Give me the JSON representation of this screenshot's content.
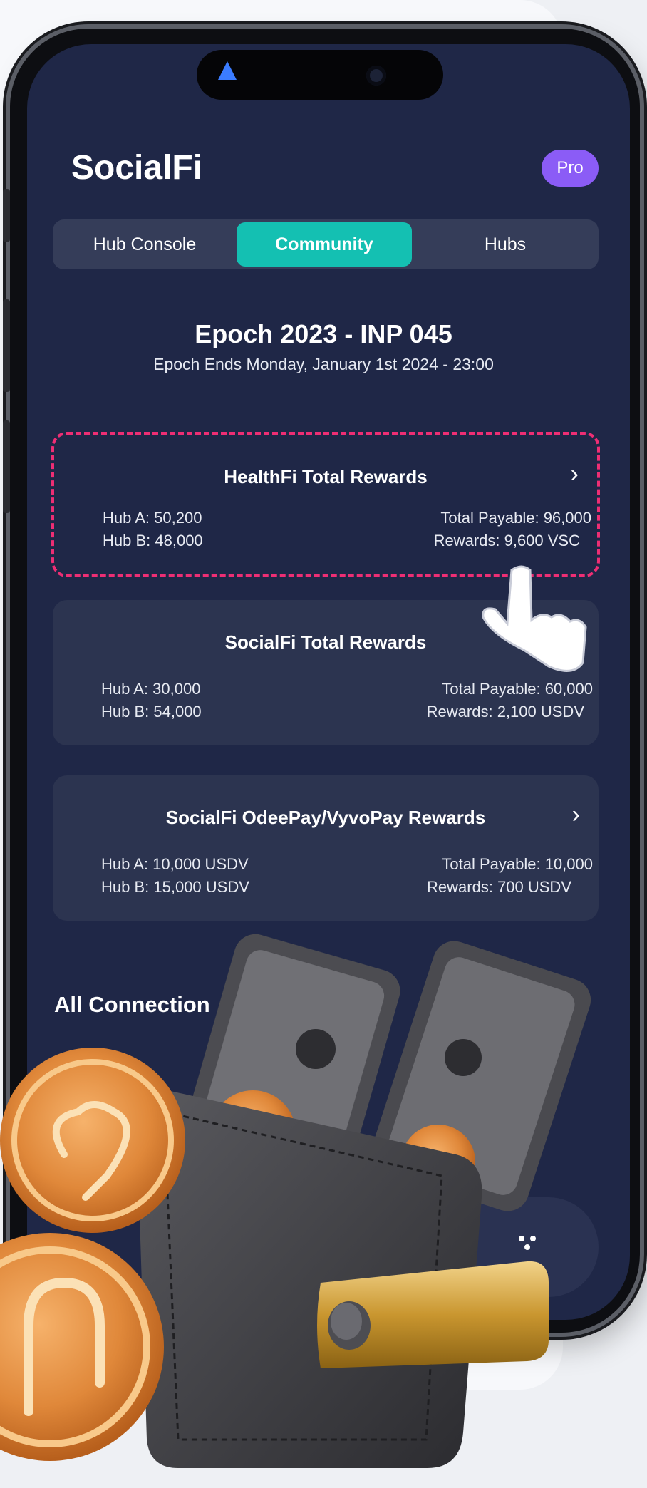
{
  "app": {
    "title": "SocialFi",
    "badge": "Pro"
  },
  "tabs": [
    {
      "label": "Hub Console",
      "active": false
    },
    {
      "label": "Community",
      "active": true
    },
    {
      "label": "Hubs",
      "active": false
    }
  ],
  "epoch": {
    "title": "Epoch 2023 - INP 045",
    "subtitle": "Epoch Ends Monday, January 1st 2024 - 23:00"
  },
  "cards": [
    {
      "title": "HealthFi Total Rewards",
      "hub_a": "Hub A: 50,200",
      "hub_b": "Hub B: 48,000",
      "total_payable": "Total Payable: 96,000",
      "rewards": "Rewards: 9,600 VSC",
      "selected": true
    },
    {
      "title": "SocialFi Total Rewards",
      "hub_a": "Hub A: 30,000",
      "hub_b": "Hub B: 54,000",
      "total_payable": "Total Payable: 60,000",
      "rewards": "Rewards: 2,100 USDV",
      "selected": false
    },
    {
      "title": "SocialFi OdeePay/VyvoPay Rewards",
      "hub_a": "Hub A: 10,000 USDV",
      "hub_b": "Hub B: 15,000 USDV",
      "total_payable": "Total Payable: 10,000",
      "rewards": "Rewards: 700 USDV",
      "selected": false
    }
  ],
  "section": {
    "all_connections": "All Connection"
  },
  "colors": {
    "screen_bg": "#1f2747",
    "card_bg": "#2c3450",
    "tab_active": "#14c0b2",
    "pro_badge": "#8b5cf6",
    "selection_dash": "#ee2e74",
    "coin": "#e08a3c"
  },
  "icons": {
    "chevron": "chevron-right-icon",
    "pointer": "hand-pointer-icon",
    "wallet": "wallet-illustration",
    "coin": "coin-illustration"
  }
}
